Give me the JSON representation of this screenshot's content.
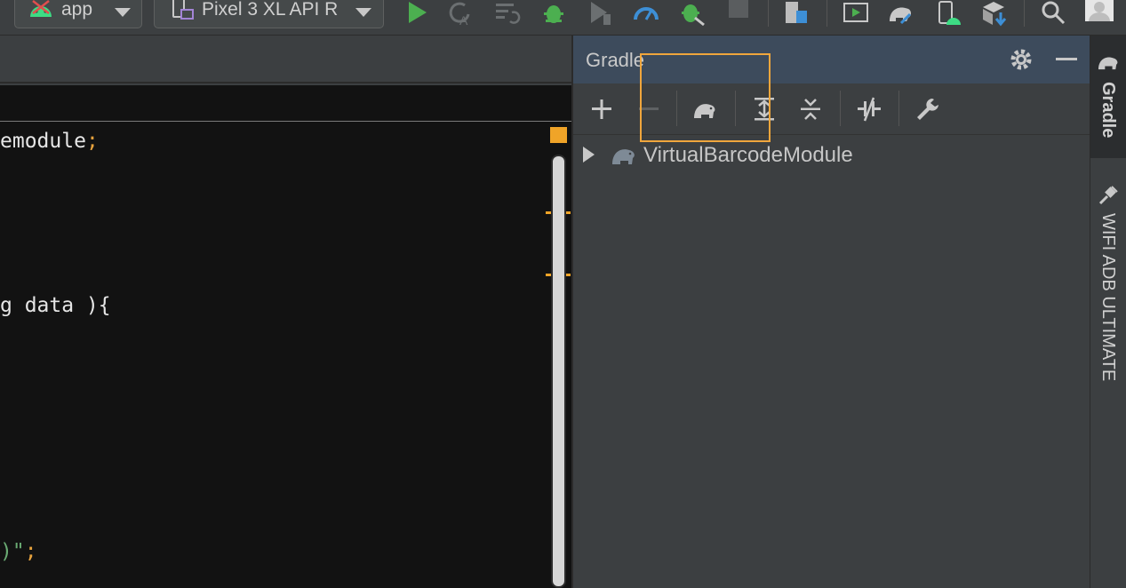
{
  "toolbar": {
    "run_config_label": "app",
    "device_label": "Pixel 3 XL API R",
    "icons": [
      "android-icon",
      "device-icon",
      "run-icon",
      "apply-changes-icon",
      "apply-code-changes-icon",
      "debug-icon",
      "profile-icon",
      "profiler-icon",
      "attach-debugger-icon",
      "stop-icon",
      "project-structure-icon",
      "emulator-icon",
      "gradle-sync-icon",
      "avd-manager-icon",
      "sdk-manager-icon",
      "search-icon",
      "avatar-icon"
    ]
  },
  "editor": {
    "lines": [
      {
        "text": "emodule",
        "tail": ";"
      },
      {
        "text": "g data ){",
        "tail": ""
      },
      {
        "text": "",
        "str": ")\"",
        "tail": ";"
      }
    ]
  },
  "gradle_panel": {
    "title": "Gradle",
    "toolbar_icons": [
      "add-icon",
      "remove-icon",
      "gradle-elephant-icon",
      "expand-all-icon",
      "collapse-all-icon",
      "toggle-offline-icon",
      "settings-wrench-icon"
    ],
    "tree": [
      {
        "label": "VirtualBarcodeModule",
        "expanded": false
      }
    ]
  },
  "right_strip": {
    "tabs": [
      {
        "label": "Gradle",
        "active": true
      },
      {
        "label": "WIFI ADB ULTIMATE",
        "active": false
      }
    ]
  },
  "colors": {
    "accent_highlight": "#f0a63c",
    "panel_header": "#3d4b5c",
    "editor_bg": "#121212",
    "run_green": "#4caf50"
  }
}
